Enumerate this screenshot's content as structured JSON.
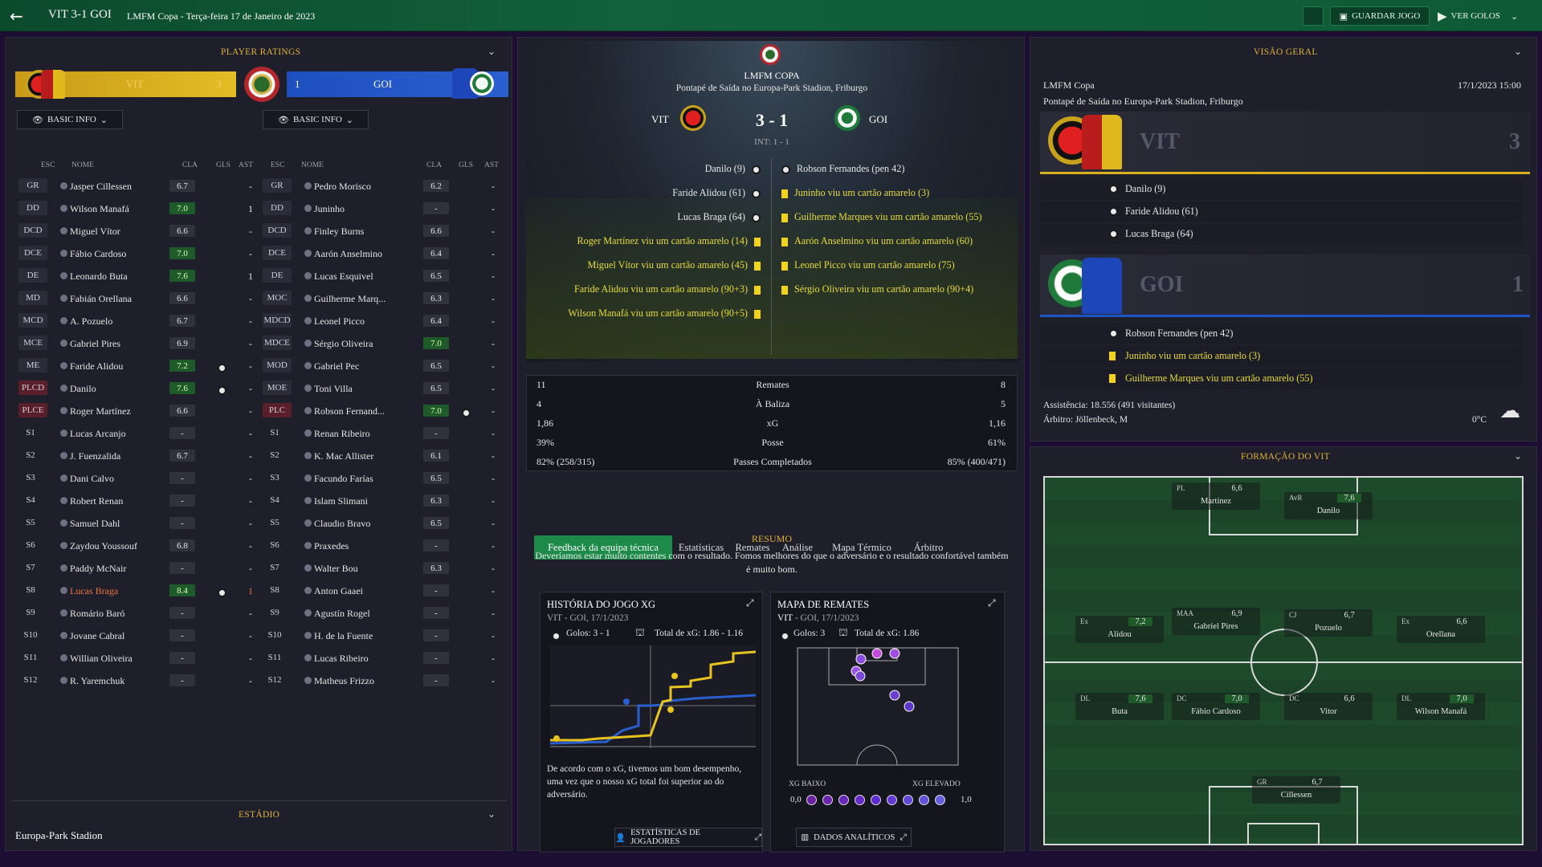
{
  "topbar": {
    "title": "VIT 3-1 GOI",
    "subtitle": "LMFM Copa - Terça-feira 17 de Janeiro de 2023",
    "save_label": "GUARDAR JOGO",
    "goals_label": "VER GOLOS"
  },
  "ratings": {
    "header": "PLAYER RATINGS",
    "home_bar": {
      "name": "VIT",
      "score": "3"
    },
    "away_bar": {
      "score": "1",
      "name": "GOI"
    },
    "filter_label": "BASIC INFO",
    "cols": {
      "pos": "ESC",
      "name": "NOME",
      "rating": "CLA",
      "goals": "GLS",
      "assists": "AST"
    },
    "home": [
      {
        "pos": "GR",
        "name": "Jasper Cillessen",
        "rating": "6.7",
        "g": "",
        "a": "-"
      },
      {
        "pos": "DD",
        "name": "Wilson Manafá",
        "rating": "7.0",
        "g": "",
        "a": "1"
      },
      {
        "pos": "DCD",
        "name": "Miguel Vítor",
        "rating": "6.6",
        "g": "",
        "a": "-"
      },
      {
        "pos": "DCE",
        "name": "Fábio Cardoso",
        "rating": "7.0",
        "g": "",
        "a": "-"
      },
      {
        "pos": "DE",
        "name": "Leonardo Buta",
        "rating": "7.6",
        "g": "",
        "a": "1"
      },
      {
        "pos": "MD",
        "name": "Fabián Orellana",
        "rating": "6.6",
        "g": "",
        "a": "-"
      },
      {
        "pos": "MCD",
        "name": "A. Pozuelo",
        "rating": "6.7",
        "g": "",
        "a": "-"
      },
      {
        "pos": "MCE",
        "name": "Gabriel Pires",
        "rating": "6.9",
        "g": "",
        "a": "-"
      },
      {
        "pos": "ME",
        "name": "Faride Alidou",
        "rating": "7.2",
        "g": "ball",
        "a": "-"
      },
      {
        "pos": "PLCD",
        "name": "Danilo",
        "rating": "7.6",
        "g": "ball",
        "a": "-"
      },
      {
        "pos": "PLCE",
        "name": "Roger Martínez",
        "rating": "6.6",
        "g": "",
        "a": "-"
      },
      {
        "pos": "S1",
        "name": "Lucas Arcanjo",
        "rating": "-",
        "g": "",
        "a": "-"
      },
      {
        "pos": "S2",
        "name": "J. Fuenzalida",
        "rating": "6.7",
        "g": "",
        "a": "-"
      },
      {
        "pos": "S3",
        "name": "Dani Calvo",
        "rating": "-",
        "g": "",
        "a": "-"
      },
      {
        "pos": "S4",
        "name": "Robert Renan",
        "rating": "-",
        "g": "",
        "a": "-"
      },
      {
        "pos": "S5",
        "name": "Samuel Dahl",
        "rating": "-",
        "g": "",
        "a": "-"
      },
      {
        "pos": "S6",
        "name": "Zaydou Youssouf",
        "rating": "6.8",
        "g": "",
        "a": "-"
      },
      {
        "pos": "S7",
        "name": "Paddy McNair",
        "rating": "-",
        "g": "",
        "a": "-"
      },
      {
        "pos": "S8",
        "name": "Lucas Braga",
        "rating": "8.4",
        "g": "ball",
        "a": "1"
      },
      {
        "pos": "S9",
        "name": "Romário Baró",
        "rating": "-",
        "g": "",
        "a": "-"
      },
      {
        "pos": "S10",
        "name": "Jovane Cabral",
        "rating": "-",
        "g": "",
        "a": "-"
      },
      {
        "pos": "S11",
        "name": "Willian Oliveira",
        "rating": "-",
        "g": "",
        "a": "-"
      },
      {
        "pos": "S12",
        "name": "R. Yaremchuk",
        "rating": "-",
        "g": "",
        "a": "-"
      }
    ],
    "away": [
      {
        "pos": "GR",
        "name": "Pedro Morisco",
        "rating": "6.2",
        "g": "",
        "a": "-"
      },
      {
        "pos": "DD",
        "name": "Juninho",
        "rating": "-",
        "g": "",
        "a": "-"
      },
      {
        "pos": "DCD",
        "name": "Finley Burns",
        "rating": "6.6",
        "g": "",
        "a": "-"
      },
      {
        "pos": "DCE",
        "name": "Aarón Anselmino",
        "rating": "6.4",
        "g": "",
        "a": "-"
      },
      {
        "pos": "DE",
        "name": "Lucas Esquivel",
        "rating": "6.5",
        "g": "",
        "a": "-"
      },
      {
        "pos": "MOC",
        "name": "Guilherme Marq...",
        "rating": "6.3",
        "g": "",
        "a": "-"
      },
      {
        "pos": "MDCD",
        "name": "Leonel Picco",
        "rating": "6.4",
        "g": "",
        "a": "-"
      },
      {
        "pos": "MDCE",
        "name": "Sérgio Oliveira",
        "rating": "7.0",
        "g": "",
        "a": "-"
      },
      {
        "pos": "MOD",
        "name": "Gabriel Pec",
        "rating": "6.5",
        "g": "",
        "a": "-"
      },
      {
        "pos": "MOE",
        "name": "Toni Villa",
        "rating": "6.5",
        "g": "",
        "a": "-"
      },
      {
        "pos": "PLC",
        "name": "Robson Fernand...",
        "rating": "7.0",
        "g": "ball",
        "a": "-"
      },
      {
        "pos": "S1",
        "name": "Renan Ribeiro",
        "rating": "-",
        "g": "",
        "a": "-"
      },
      {
        "pos": "S2",
        "name": "K. Mac Allister",
        "rating": "6.1",
        "g": "",
        "a": "-"
      },
      {
        "pos": "S3",
        "name": "Facundo Farías",
        "rating": "6.5",
        "g": "",
        "a": "-"
      },
      {
        "pos": "S4",
        "name": "Islam Slimani",
        "rating": "6.3",
        "g": "",
        "a": "-"
      },
      {
        "pos": "S5",
        "name": "Claudio Bravo",
        "rating": "6.5",
        "g": "",
        "a": "-"
      },
      {
        "pos": "S6",
        "name": "Praxedes",
        "rating": "-",
        "g": "",
        "a": "-"
      },
      {
        "pos": "S7",
        "name": "Walter Bou",
        "rating": "6.3",
        "g": "",
        "a": "-"
      },
      {
        "pos": "S8",
        "name": "Anton Gaaei",
        "rating": "-",
        "g": "",
        "a": "-"
      },
      {
        "pos": "S9",
        "name": "Agustín Rogel",
        "rating": "-",
        "g": "",
        "a": "-"
      },
      {
        "pos": "S10",
        "name": "H. de la Fuente",
        "rating": "-",
        "g": "",
        "a": "-"
      },
      {
        "pos": "S11",
        "name": "Lucas Ribeiro",
        "rating": "-",
        "g": "",
        "a": "-"
      },
      {
        "pos": "S12",
        "name": "Matheus Frizzo",
        "rating": "-",
        "g": "",
        "a": "-"
      }
    ],
    "stadium_header": "ESTÁDIO",
    "stadium_name": "Europa-Park Stadion"
  },
  "match": {
    "competition": "LMFM COPA",
    "venue": "Pontapé de Saída no Europa-Park Stadion, Friburgo",
    "home": "VIT",
    "away": "GOI",
    "score": "3 - 1",
    "ht": "INT: 1 - 1",
    "home_events": [
      {
        "t": "Danilo (9)",
        "k": "goal"
      },
      {
        "t": "Faride Alidou (61)",
        "k": "goal"
      },
      {
        "t": "Lucas Braga (64)",
        "k": "goal"
      },
      {
        "t": "Roger Martínez viu um cartão amarelo (14)",
        "k": "card"
      },
      {
        "t": "Miguel Vítor viu um cartão amarelo (45)",
        "k": "card"
      },
      {
        "t": "Faride Alidou viu um cartão amarelo (90+3)",
        "k": "card"
      },
      {
        "t": "Wilson Manafá viu um cartão amarelo (90+5)",
        "k": "card"
      }
    ],
    "away_events": [
      {
        "t": "Robson Fernandes (pen 42)",
        "k": "goal"
      },
      {
        "t": "Juninho viu um cartão amarelo (3)",
        "k": "card"
      },
      {
        "t": "Guilherme Marques viu um cartão amarelo (55)",
        "k": "card"
      },
      {
        "t": "Aarón Anselmino viu um cartão amarelo (60)",
        "k": "card"
      },
      {
        "t": "Leonel Picco viu um cartão amarelo (75)",
        "k": "card"
      },
      {
        "t": "Sérgio Oliveira viu um cartão amarelo (90+4)",
        "k": "card"
      }
    ],
    "stats": [
      {
        "h": "11",
        "l": "Remates",
        "a": "8"
      },
      {
        "h": "4",
        "l": "À Baliza",
        "a": "5"
      },
      {
        "h": "1,86",
        "l": "xG",
        "a": "1,16"
      },
      {
        "h": "39%",
        "l": "Posse",
        "a": "61%"
      },
      {
        "h": "82% (258/315)",
        "l": "Passes Completados",
        "a": "85% (400/471)"
      }
    ],
    "tabs": [
      "Feedback da equipa técnica",
      "Estatísticas",
      "Remates",
      "Análise",
      "Mapa Térmico",
      "Árbitro"
    ],
    "summary_title": "RESUMO",
    "summary": "Deveríamos estar muito contentes com o resultado. Fomos melhores do que o adversário e o resultado confortável também é muito bom.",
    "xg_card": {
      "title": "HISTÓRIA DO JOGO XG",
      "sub": "VIT - GOI, 17/1/2023",
      "goals": "Golos: 3 - 1",
      "total": "Total de xG: 1.86 - 1.16",
      "desc": "De acordo com o xG, tivemos um bom desempenho, uma vez que o nosso xG total foi superior ao do adversário."
    },
    "shot_card": {
      "title": "MAPA DE REMATES",
      "sub_team": "VIT",
      "sub": " - GOI, 17/1/2023",
      "goals": "Golos: 3",
      "total": "Total de xG: 1.86",
      "low": "XG BAIXO",
      "high": "XG ELEVADO",
      "min": "0,0",
      "max": "1,0"
    },
    "btn_players": "ESTATÍSTICAS DE JOGADORES",
    "btn_analytics": "DADOS ANALÍTICOS"
  },
  "overview": {
    "header": "VISÃO GERAL",
    "competition": "LMFM Copa",
    "datetime": "17/1/2023 15:00",
    "venue": "Pontapé de Saída no Europa-Park Stadion, Friburgo",
    "home": "VIT",
    "home_score": "3",
    "home_events": [
      "Danilo (9)",
      "Faride Alidou (61)",
      "Lucas Braga (64)"
    ],
    "away": "GOI",
    "away_score": "1",
    "away_events": [
      {
        "t": "Robson Fernandes (pen 42)",
        "k": "goal"
      },
      {
        "t": "Juninho viu um cartão amarelo (3)",
        "k": "card"
      },
      {
        "t": "Guilherme Marques viu um cartão amarelo (55)",
        "k": "card"
      }
    ],
    "attendance": "Assistência: 18.556 (491 visitantes)",
    "referee": "Árbitro: Jöllenbeck, M",
    "temp": "0°C"
  },
  "formation": {
    "header": "FORMAÇÃO DO VIT",
    "players": [
      {
        "pos": "PL",
        "name": "Martínez",
        "r": "6,6"
      },
      {
        "pos": "AvR",
        "name": "Danilo",
        "r": "7,6"
      },
      {
        "pos": "Ex",
        "name": "Alidou",
        "r": "7,2"
      },
      {
        "pos": "MAA",
        "name": "Gabriel Pires",
        "r": "6,9"
      },
      {
        "pos": "CJ",
        "name": "Pozuelo",
        "r": "6,7"
      },
      {
        "pos": "Ex",
        "name": "Orellana",
        "r": "6,6"
      },
      {
        "pos": "DL",
        "name": "Buta",
        "r": "7,6"
      },
      {
        "pos": "DC",
        "name": "Fábio Cardoso",
        "r": "7,0"
      },
      {
        "pos": "DC",
        "name": "Vitor",
        "r": "6,6"
      },
      {
        "pos": "DL",
        "name": "Wilson Manafá",
        "r": "7,0"
      },
      {
        "pos": "GR",
        "name": "Cillessen",
        "r": "6,7"
      }
    ]
  },
  "colors": {
    "accent": "#e0b23a",
    "topbar": "#11613a",
    "home_yellow": "#d9b11c",
    "away_blue": "#1f54c8",
    "card": "#f3d21a"
  }
}
